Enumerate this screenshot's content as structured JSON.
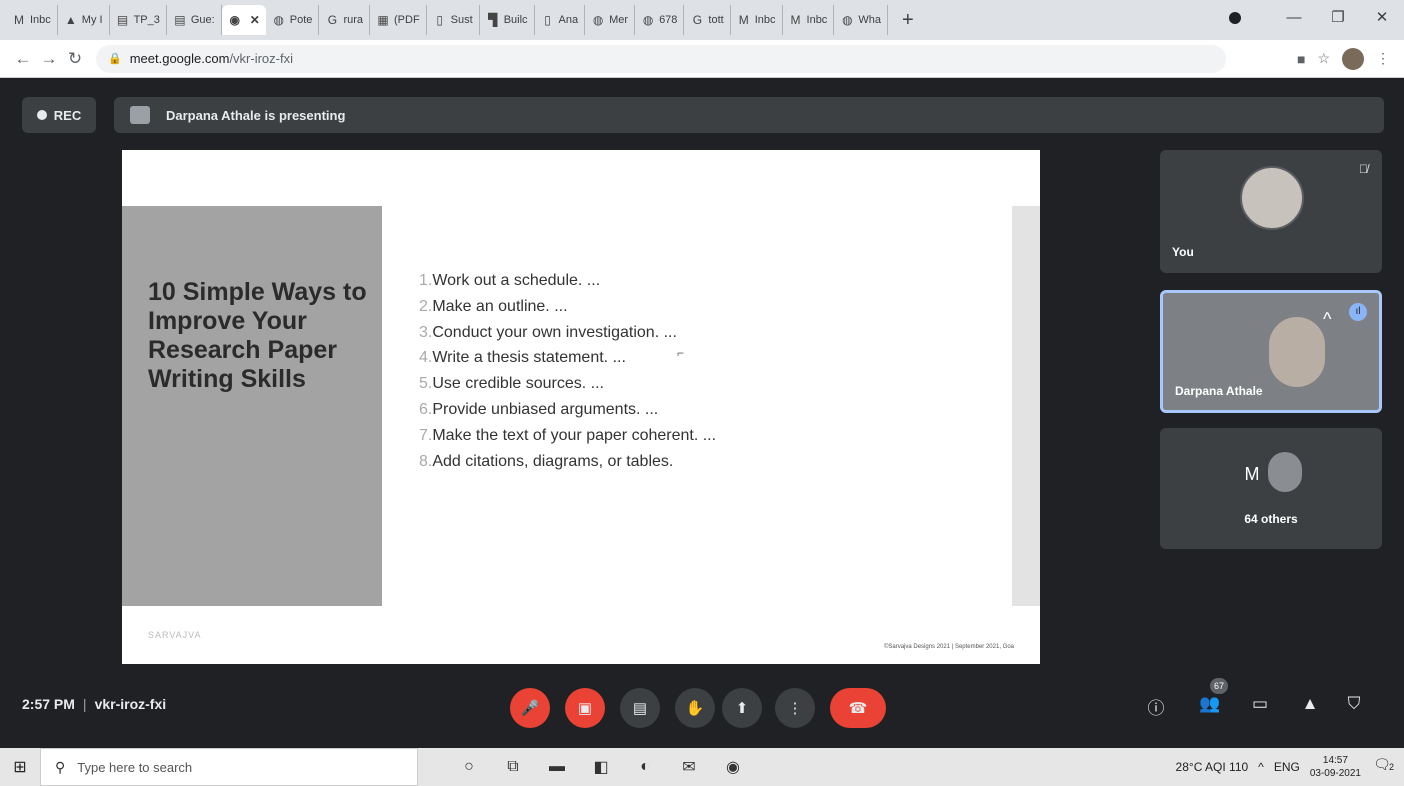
{
  "browser": {
    "tabs": [
      {
        "icon": "gmail-icon",
        "glyph": "M",
        "label": "Inbc"
      },
      {
        "icon": "drive-icon",
        "glyph": "▲",
        "label": "My I"
      },
      {
        "icon": "docs-icon",
        "glyph": "▤",
        "label": "TP_3"
      },
      {
        "icon": "docs-icon",
        "glyph": "▤",
        "label": "Gue:"
      },
      {
        "icon": "meet-icon",
        "glyph": "◉",
        "label": "",
        "active": true
      },
      {
        "icon": "globe-icon",
        "glyph": "◍",
        "label": "Pote"
      },
      {
        "icon": "google-icon",
        "glyph": "G",
        "label": "rura"
      },
      {
        "icon": "pdf-icon",
        "glyph": "▦",
        "label": "(PDF"
      },
      {
        "icon": "page-icon",
        "glyph": "▯",
        "label": "Sust"
      },
      {
        "icon": "flag-icon",
        "glyph": "▜",
        "label": "Builc"
      },
      {
        "icon": "page-icon",
        "glyph": "▯",
        "label": "Ana"
      },
      {
        "icon": "globe-icon",
        "glyph": "◍",
        "label": "Mer"
      },
      {
        "icon": "globe-icon",
        "glyph": "◍",
        "label": "678"
      },
      {
        "icon": "google-icon",
        "glyph": "G",
        "label": "tott"
      },
      {
        "icon": "gmail-icon",
        "glyph": "M",
        "label": "Inbc"
      },
      {
        "icon": "gmail-icon",
        "glyph": "M",
        "label": "Inbc"
      },
      {
        "icon": "globe-icon",
        "glyph": "◍",
        "label": "Wha"
      }
    ],
    "new_tab": "+",
    "url_host": "meet.google.com",
    "url_path": "/vkr-iroz-fxi"
  },
  "meet": {
    "rec_label": "REC",
    "presenting_text": "Darpana Athale is presenting",
    "time": "2:57 PM",
    "meeting_code": "vkr-iroz-fxi",
    "participant_count": "67",
    "tiles": {
      "you_label": "You",
      "presenter_label": "Darpana Athale",
      "others_initial": "M",
      "others_label": "64 others"
    }
  },
  "slide": {
    "title": "10 Simple Ways to Improve Your Research Paper Writing Skills",
    "items": [
      {
        "num": "1.",
        "text": "Work out a schedule. ..."
      },
      {
        "num": "2.",
        "text": "Make an outline. ..."
      },
      {
        "num": "3.",
        "text": "Conduct your own investigation. ..."
      },
      {
        "num": "4.",
        "text": "Write a thesis statement. ..."
      },
      {
        "num": "5.",
        "text": "Use credible sources. ..."
      },
      {
        "num": "6.",
        "text": "Provide unbiased arguments. ..."
      },
      {
        "num": "7.",
        "text": "Make the text of your paper coherent. ..."
      },
      {
        "num": "8.",
        "text": "Add citations, diagrams, or tables."
      }
    ],
    "footer_logo": "SARVAJVA",
    "footer_right": "©Sarvajva Designs 2021 | September 2021, Goa"
  },
  "taskbar": {
    "search_placeholder": "Type here to search",
    "weather": "28°C AQI 110",
    "lang": "ENG",
    "clock_time": "14:57",
    "clock_date": "03-09-2021",
    "notifications": "2"
  }
}
